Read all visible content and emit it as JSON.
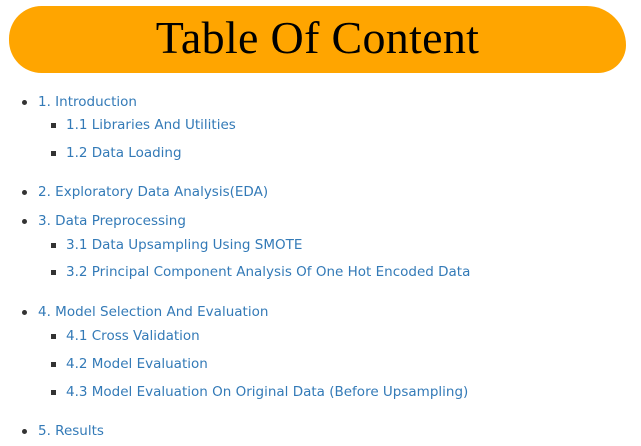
{
  "banner": {
    "title": "Table Of Content",
    "color": "#ffa500"
  },
  "link_color": "#337ab7",
  "toc": [
    {
      "label": "1. Introduction"
    },
    {
      "label": "1.1 Libraries And Utilities"
    },
    {
      "label": "1.2 Data Loading"
    },
    {
      "label": "2. Exploratory Data Analysis(EDA)"
    },
    {
      "label": "3. Data Preprocessing"
    },
    {
      "label": "3.1 Data Upsampling Using SMOTE"
    },
    {
      "label": "3.2 Principal Component Analysis Of One Hot Encoded Data"
    },
    {
      "label": "4. Model Selection And Evaluation"
    },
    {
      "label": "4.1 Cross Validation"
    },
    {
      "label": "4.2 Model Evaluation"
    },
    {
      "label": "4.3 Model Evaluation On Original Data (Before Upsampling)"
    },
    {
      "label": "5. Results"
    }
  ]
}
